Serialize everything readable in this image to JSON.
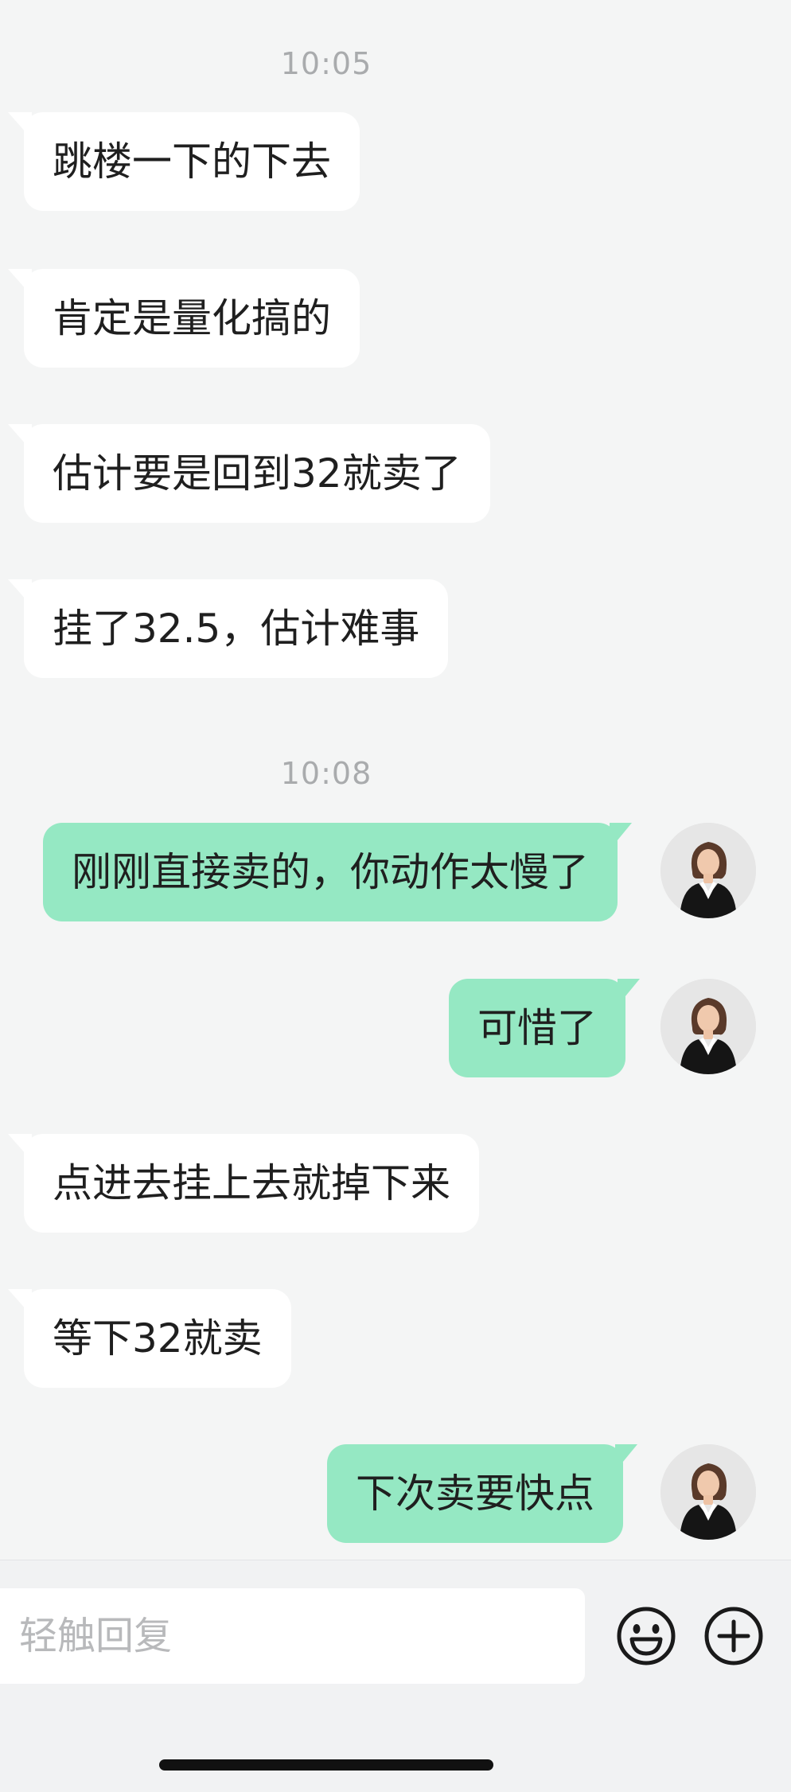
{
  "timestamps": [
    "10:05",
    "10:08"
  ],
  "messages": [
    {
      "side": "incoming",
      "text": "跳楼一下的下去"
    },
    {
      "side": "incoming",
      "text": "肯定是量化搞的"
    },
    {
      "side": "incoming",
      "text": "估计要是回到32就卖了"
    },
    {
      "side": "incoming",
      "text": "挂了32.5，估计难事"
    },
    {
      "side": "outgoing",
      "text": "刚刚直接卖的，你动作太慢了"
    },
    {
      "side": "outgoing",
      "text": "可惜了"
    },
    {
      "side": "incoming",
      "text": "点进去挂上去就掉下来"
    },
    {
      "side": "incoming",
      "text": "等下32就卖"
    },
    {
      "side": "outgoing",
      "text": "下次卖要快点"
    }
  ],
  "input": {
    "placeholder": "轻触回复"
  },
  "icons": {
    "emoji": "smiley-icon",
    "more": "plus-circle-icon"
  },
  "colors": {
    "background": "#f4f5f5",
    "incoming_bubble": "#ffffff",
    "outgoing_bubble": "#95e8c3",
    "timestamp": "#a9abad"
  }
}
